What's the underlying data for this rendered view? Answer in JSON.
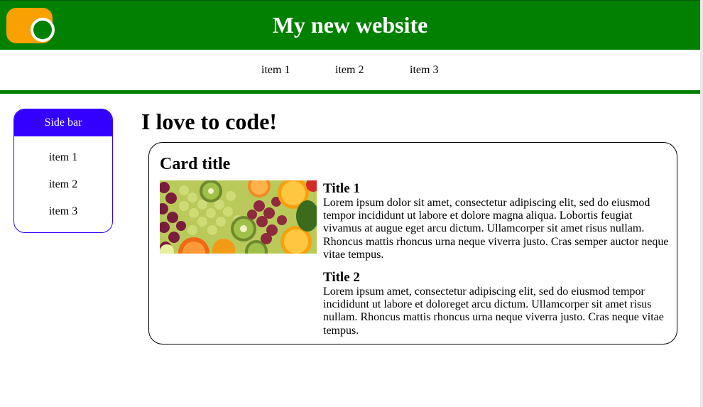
{
  "header": {
    "title": "My new website",
    "colors": {
      "bar": "#028002",
      "toggle": "#f9a103"
    },
    "toggle_icon": "theme-toggle"
  },
  "nav": {
    "items": [
      {
        "label": "item 1"
      },
      {
        "label": "item 2"
      },
      {
        "label": "item 3"
      }
    ]
  },
  "sidebar": {
    "title": "Side bar",
    "accent": "#3300ff",
    "items": [
      {
        "label": "item 1"
      },
      {
        "label": "item 2"
      },
      {
        "label": "item 3"
      }
    ]
  },
  "main": {
    "heading": "I love to code!",
    "card": {
      "title": "Card title",
      "image": "fruit-photo",
      "entries": [
        {
          "title": "Title 1",
          "body": "Lorem ipsum dolor sit amet, consectetur adipiscing elit, sed do eiusmod tempor incididunt ut labore et dolore magna aliqua. Lobortis feugiat vivamus at augue eget arcu dictum. Ullamcorper sit amet risus nullam. Rhoncus mattis rhoncus urna neque viverra justo. Cras semper auctor neque vitae tempus."
        },
        {
          "title": "Title 2",
          "body": "Lorem ipsum amet, consectetur adipiscing elit, sed do eiusmod tempor incididunt ut labore et doloreget arcu dictum. Ullamcorper sit amet risus nullam. Rhoncus mattis rhoncus urna neque viverra justo. Cras neque vitae tempus."
        }
      ]
    }
  }
}
